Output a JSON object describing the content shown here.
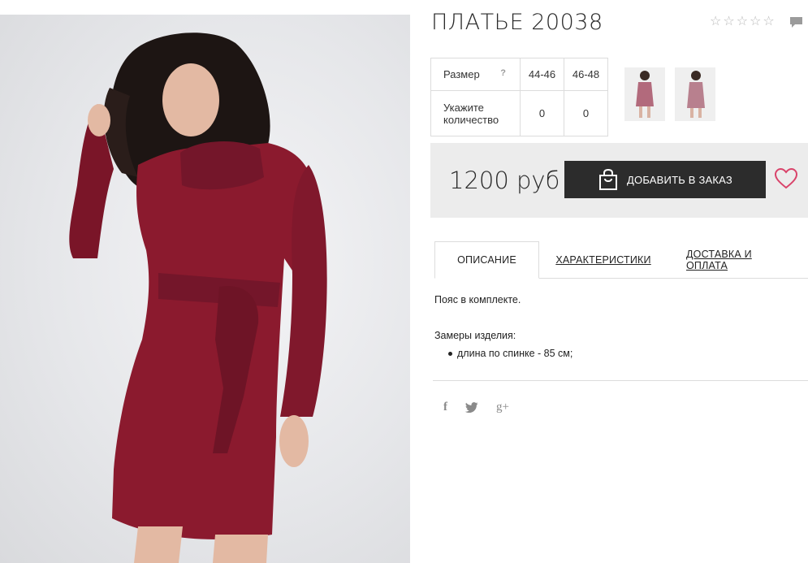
{
  "product": {
    "title": "ПЛАТЬЕ 20038",
    "stars": [
      "☆",
      "☆",
      "☆",
      "☆",
      "☆"
    ],
    "image": {
      "dress_color": "#8b1a2e",
      "background_color": "#e8e9ec"
    }
  },
  "size_table": {
    "size_label": "Размер",
    "help": "?",
    "sizes": [
      "44-46",
      "46-48"
    ],
    "qty_label": "Укажите количество",
    "quantities": [
      "0",
      "0"
    ]
  },
  "thumbnails": [
    {
      "name": "thumb-front",
      "icon": "dress-photo"
    },
    {
      "name": "thumb-side",
      "icon": "dress-photo"
    }
  ],
  "order": {
    "price": "1200 руб",
    "add_label": "ДОБАВИТЬ В ЗАКАЗ",
    "bag_icon": "shopping-bag-icon",
    "wish_icon": "heart-icon",
    "accent": "#d9436a"
  },
  "tabs": [
    {
      "label": "ОПИСАНИЕ",
      "active": true
    },
    {
      "label": "ХАРАКТЕРИСТИКИ",
      "active": false
    },
    {
      "label": "ДОСТАВКА И ОПЛАТА",
      "active": false
    }
  ],
  "description": {
    "belt": "Пояс в комплекте.",
    "measures_title": "Замеры изделия:",
    "measures": [
      "длина по спинке - 85 см;"
    ]
  },
  "share": {
    "facebook": "f",
    "twitter": "🐦",
    "google": "g+"
  }
}
